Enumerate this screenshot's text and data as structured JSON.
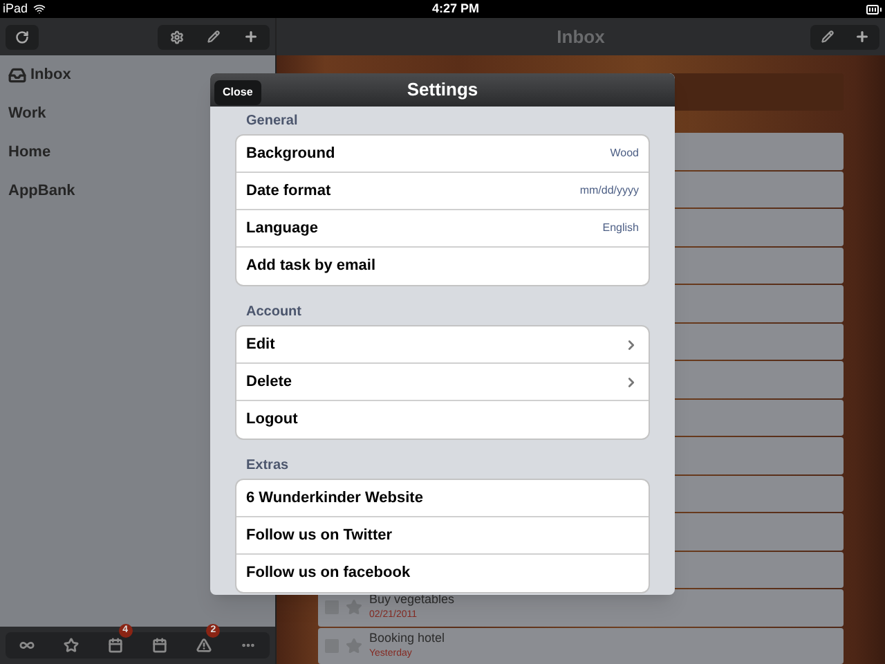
{
  "status_bar": {
    "device": "iPad",
    "time": "4:27 PM"
  },
  "sidebar": {
    "lists": [
      {
        "label": "Inbox",
        "kind": "inbox"
      },
      {
        "label": "Work",
        "kind": "list"
      },
      {
        "label": "Home",
        "kind": "list"
      },
      {
        "label": "AppBank",
        "kind": "list"
      }
    ],
    "bottom_toolbar": [
      {
        "kind": "infinity"
      },
      {
        "kind": "star"
      },
      {
        "kind": "calendar",
        "badge": "4"
      },
      {
        "kind": "calendar"
      },
      {
        "kind": "alert",
        "badge": "2"
      },
      {
        "kind": "more"
      }
    ]
  },
  "main": {
    "title": "Inbox",
    "tasks": [
      {
        "title": "Buy vegetables",
        "date": "02/21/2011",
        "checked": false
      },
      {
        "title": "Booking hotel",
        "date": "Yesterday",
        "checked": false
      }
    ]
  },
  "settings": {
    "title": "Settings",
    "close_button": "Close",
    "sections": [
      {
        "title": "General",
        "rows": [
          {
            "label": "Background",
            "kind": "value",
            "value": "Wood"
          },
          {
            "label": "Date format",
            "kind": "value",
            "value": "mm/dd/yyyy"
          },
          {
            "label": "Language",
            "kind": "value",
            "value": "English"
          },
          {
            "label": "Add task by email",
            "kind": "plain"
          }
        ]
      },
      {
        "title": "Account",
        "rows": [
          {
            "label": "Edit",
            "kind": "disclosure"
          },
          {
            "label": "Delete",
            "kind": "disclosure"
          },
          {
            "label": "Logout",
            "kind": "plain"
          }
        ]
      },
      {
        "title": "Extras",
        "rows": [
          {
            "label": "6 Wunderkinder Website",
            "kind": "plain"
          },
          {
            "label": "Follow us on Twitter",
            "kind": "plain"
          },
          {
            "label": "Follow us on facebook",
            "kind": "plain"
          }
        ]
      }
    ]
  }
}
